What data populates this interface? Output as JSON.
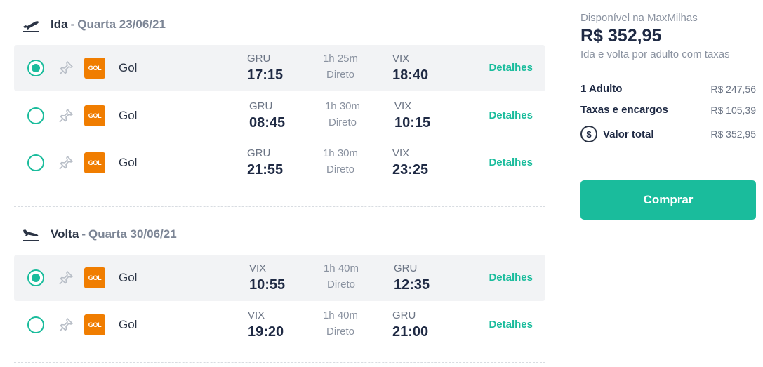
{
  "outbound": {
    "direction": "Ida",
    "separator": "-",
    "date": "Quarta 23/06/21",
    "flights": [
      {
        "selected": true,
        "airline": "Gol",
        "logo_text": "GOL",
        "from": "GRU",
        "dep": "17:15",
        "duration": "1h 25m",
        "type": "Direto",
        "to": "VIX",
        "arr": "18:40",
        "details": "Detalhes"
      },
      {
        "selected": false,
        "airline": "Gol",
        "logo_text": "GOL",
        "from": "GRU",
        "dep": "08:45",
        "duration": "1h 30m",
        "type": "Direto",
        "to": "VIX",
        "arr": "10:15",
        "details": "Detalhes"
      },
      {
        "selected": false,
        "airline": "Gol",
        "logo_text": "GOL",
        "from": "GRU",
        "dep": "21:55",
        "duration": "1h 30m",
        "type": "Direto",
        "to": "VIX",
        "arr": "23:25",
        "details": "Detalhes"
      }
    ]
  },
  "return": {
    "direction": "Volta",
    "separator": "-",
    "date": "Quarta 30/06/21",
    "flights": [
      {
        "selected": true,
        "airline": "Gol",
        "logo_text": "GOL",
        "from": "VIX",
        "dep": "10:55",
        "duration": "1h 40m",
        "type": "Direto",
        "to": "GRU",
        "arr": "12:35",
        "details": "Detalhes"
      },
      {
        "selected": false,
        "airline": "Gol",
        "logo_text": "GOL",
        "from": "VIX",
        "dep": "19:20",
        "duration": "1h 40m",
        "type": "Direto",
        "to": "GRU",
        "arr": "21:00",
        "details": "Detalhes"
      }
    ]
  },
  "summary": {
    "available": "Disponível na MaxMilhas",
    "price": "R$ 352,95",
    "price_note": "Ida e volta por adulto com taxas",
    "lines": [
      {
        "label": "1 Adulto",
        "value": "R$ 247,56"
      },
      {
        "label": "Taxas e encargos",
        "value": "R$ 105,39"
      },
      {
        "label": "Valor total",
        "value": "R$ 352,95"
      }
    ],
    "coin_symbol": "$",
    "buy_label": "Comprar"
  },
  "colors": {
    "accent": "#1abc9c",
    "gol": "#f07d00",
    "selected_row": "#f2f3f5"
  },
  "icons": {
    "takeoff": "plane-takeoff-icon",
    "landing": "plane-landing-icon",
    "pin": "pin-icon",
    "coin": "dollar-coin-icon"
  }
}
